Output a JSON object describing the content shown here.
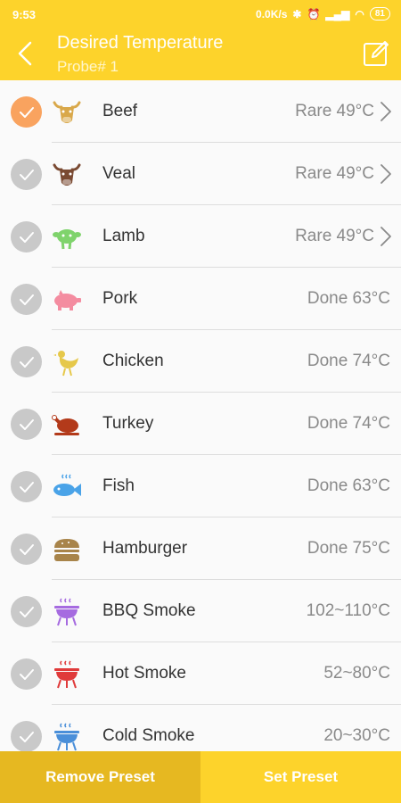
{
  "status": {
    "time": "9:53",
    "net": "0.0K/s",
    "battery": "81"
  },
  "header": {
    "title": "Desired Temperature",
    "subtitle": "Probe# 1"
  },
  "items": [
    {
      "name": "Beef",
      "value": "Rare 49°C",
      "selected": true,
      "chevron": true,
      "icon": "cow-head-icon",
      "color": "#d9a84a"
    },
    {
      "name": "Veal",
      "value": "Rare 49°C",
      "selected": false,
      "chevron": true,
      "icon": "calf-head-icon",
      "color": "#7a4a32"
    },
    {
      "name": "Lamb",
      "value": "Rare 49°C",
      "selected": false,
      "chevron": true,
      "icon": "sheep-head-icon",
      "color": "#7fd36c"
    },
    {
      "name": "Pork",
      "value": "Done 63°C",
      "selected": false,
      "chevron": false,
      "icon": "pig-icon",
      "color": "#f48ca0"
    },
    {
      "name": "Chicken",
      "value": "Done 74°C",
      "selected": false,
      "chevron": false,
      "icon": "chicken-icon",
      "color": "#e6c84a"
    },
    {
      "name": "Turkey",
      "value": "Done 74°C",
      "selected": false,
      "chevron": false,
      "icon": "roast-turkey-icon",
      "color": "#b33a1a"
    },
    {
      "name": "Fish",
      "value": "Done 63°C",
      "selected": false,
      "chevron": false,
      "icon": "fish-icon",
      "color": "#4aa3e8"
    },
    {
      "name": "Hamburger",
      "value": "Done 75°C",
      "selected": false,
      "chevron": false,
      "icon": "hamburger-icon",
      "color": "#a8844a"
    },
    {
      "name": "BBQ Smoke",
      "value": "102~110°C",
      "selected": false,
      "chevron": false,
      "icon": "grill-icon",
      "color": "#a66be0"
    },
    {
      "name": "Hot Smoke",
      "value": "52~80°C",
      "selected": false,
      "chevron": false,
      "icon": "grill-icon",
      "color": "#e03a3a"
    },
    {
      "name": "Cold Smoke",
      "value": "20~30°C",
      "selected": false,
      "chevron": false,
      "icon": "grill-icon",
      "color": "#4a8fd9"
    }
  ],
  "buttons": {
    "remove": "Remove Preset",
    "set": "Set Preset"
  }
}
